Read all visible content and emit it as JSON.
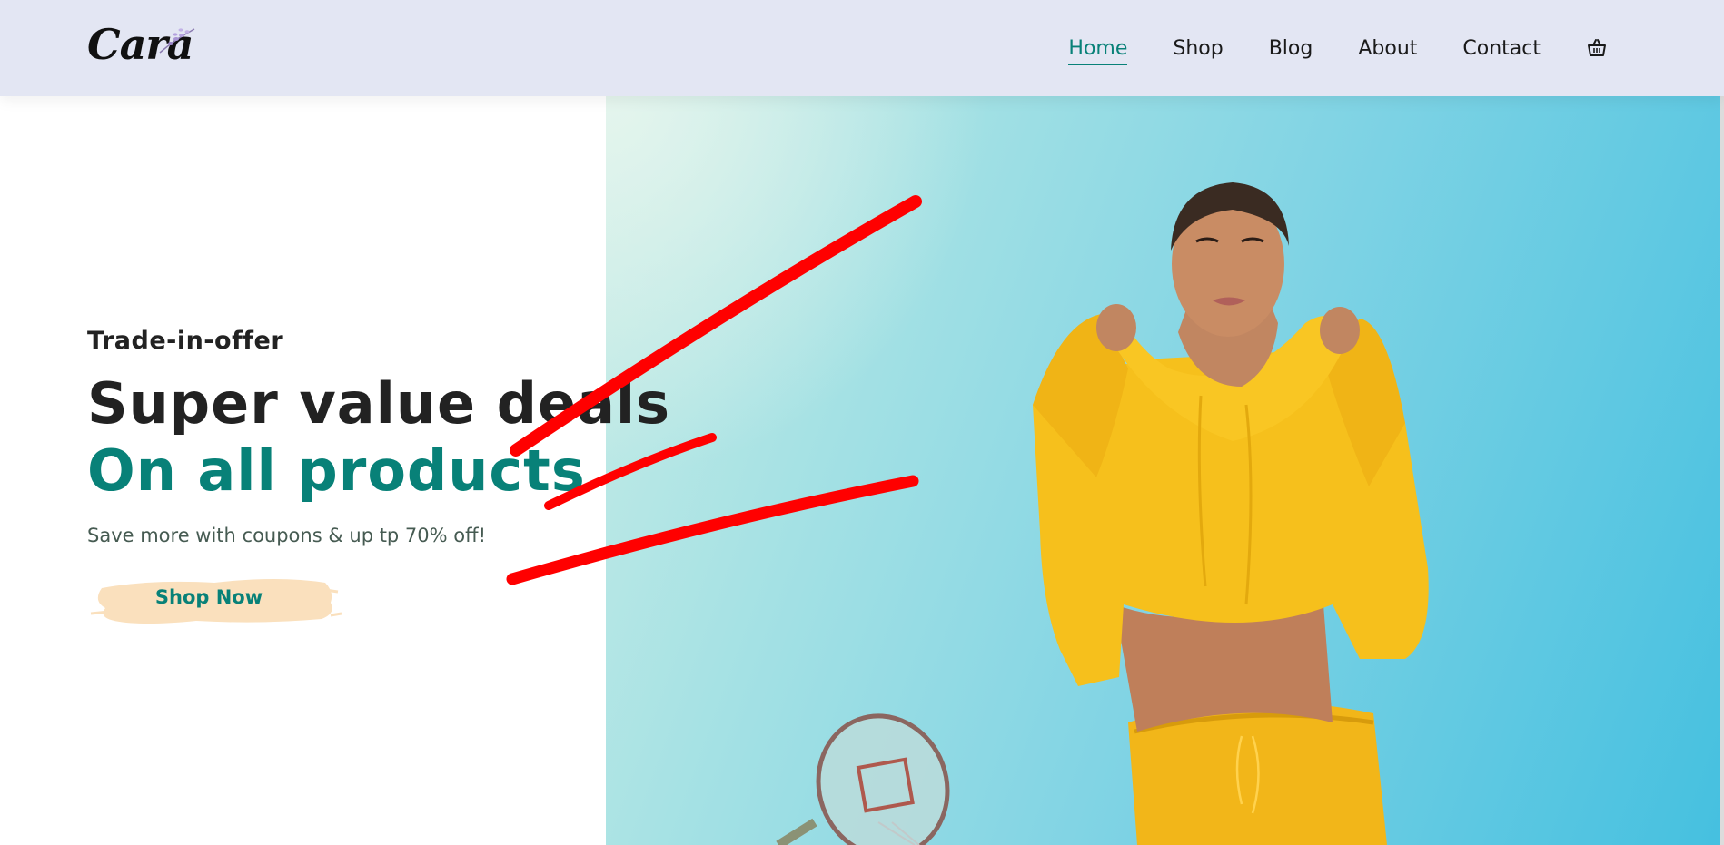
{
  "brand": {
    "logo_text": "Cara"
  },
  "nav": {
    "items": [
      {
        "label": "Home",
        "active": true
      },
      {
        "label": "Shop",
        "active": false
      },
      {
        "label": "Blog",
        "active": false
      },
      {
        "label": "About",
        "active": false
      },
      {
        "label": "Contact",
        "active": false
      }
    ],
    "cart_icon": "shopping-basket-icon"
  },
  "hero": {
    "kicker": "Trade-in-offer",
    "headline": "Super value deals",
    "headline_accent": "On all products",
    "subtext": "Save more with coupons & up tp 70% off!",
    "cta_label": "Shop Now",
    "image_description": "model-in-yellow-hoodie"
  },
  "colors": {
    "accent": "#088178",
    "header_bg": "#e3e6f3",
    "button_brush": "#fae0bd",
    "annotation_red": "#ff0000"
  }
}
